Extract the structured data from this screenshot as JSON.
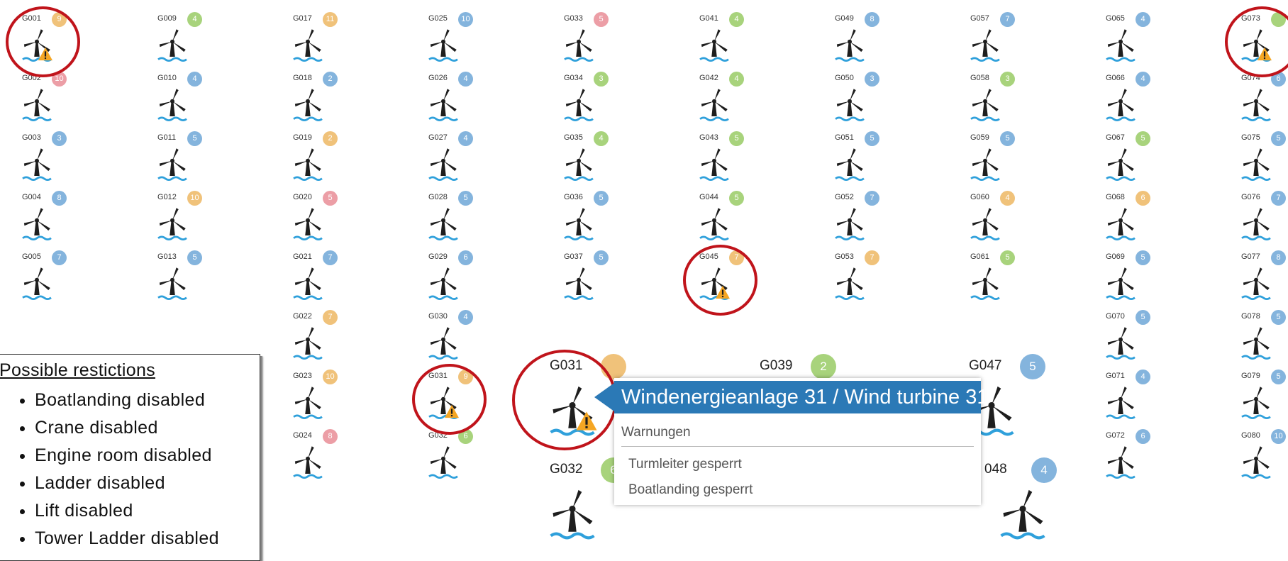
{
  "colors": {
    "blue": "#84b4dd",
    "green": "#a8d37c",
    "orange": "#f0c27a",
    "red": "#ec9ea6",
    "accent": "#2b79b6",
    "ring": "#c0141b",
    "water": "#2fa0db",
    "warning": "#f5a623"
  },
  "icons": {
    "turbine": "wind-turbine-icon",
    "warning": "warning-icon"
  },
  "turbines": [
    {
      "id": "G001",
      "count": "9",
      "status": "orange",
      "warning": true,
      "circled": true
    },
    {
      "id": "G002",
      "count": "10",
      "status": "red"
    },
    {
      "id": "G003",
      "count": "3",
      "status": "blue"
    },
    {
      "id": "G004",
      "count": "8",
      "status": "blue"
    },
    {
      "id": "G005",
      "count": "7",
      "status": "blue"
    },
    {
      "id": "G009",
      "count": "4",
      "status": "green"
    },
    {
      "id": "G010",
      "count": "4",
      "status": "blue"
    },
    {
      "id": "G011",
      "count": "5",
      "status": "blue"
    },
    {
      "id": "G012",
      "count": "10",
      "status": "orange"
    },
    {
      "id": "G013",
      "count": "5",
      "status": "blue"
    },
    {
      "id": "G017",
      "count": "11",
      "status": "orange"
    },
    {
      "id": "G018",
      "count": "2",
      "status": "blue"
    },
    {
      "id": "G019",
      "count": "2",
      "status": "orange"
    },
    {
      "id": "G020",
      "count": "5",
      "status": "red"
    },
    {
      "id": "G021",
      "count": "7",
      "status": "blue"
    },
    {
      "id": "G022",
      "count": "7",
      "status": "orange"
    },
    {
      "id": "G023",
      "count": "10",
      "status": "orange"
    },
    {
      "id": "G024",
      "count": "8",
      "status": "red"
    },
    {
      "id": "G025",
      "count": "10",
      "status": "blue"
    },
    {
      "id": "G026",
      "count": "4",
      "status": "blue"
    },
    {
      "id": "G027",
      "count": "4",
      "status": "blue"
    },
    {
      "id": "G028",
      "count": "5",
      "status": "blue"
    },
    {
      "id": "G029",
      "count": "6",
      "status": "blue"
    },
    {
      "id": "G030",
      "count": "4",
      "status": "blue"
    },
    {
      "id": "G031",
      "count": "9",
      "status": "orange",
      "warning": true,
      "circled": true
    },
    {
      "id": "G032",
      "count": "6",
      "status": "green"
    },
    {
      "id": "G033",
      "count": "5",
      "status": "red"
    },
    {
      "id": "G034",
      "count": "3",
      "status": "green"
    },
    {
      "id": "G035",
      "count": "4",
      "status": "green"
    },
    {
      "id": "G036",
      "count": "5",
      "status": "blue"
    },
    {
      "id": "G037",
      "count": "5",
      "status": "blue"
    },
    {
      "id": "G041",
      "count": "4",
      "status": "green"
    },
    {
      "id": "G042",
      "count": "4",
      "status": "green"
    },
    {
      "id": "G043",
      "count": "5",
      "status": "green"
    },
    {
      "id": "G044",
      "count": "5",
      "status": "green"
    },
    {
      "id": "G045",
      "count": "7",
      "status": "orange",
      "warning": true,
      "circled": true
    },
    {
      "id": "G049",
      "count": "8",
      "status": "blue"
    },
    {
      "id": "G050",
      "count": "3",
      "status": "blue"
    },
    {
      "id": "G051",
      "count": "5",
      "status": "blue"
    },
    {
      "id": "G052",
      "count": "7",
      "status": "blue"
    },
    {
      "id": "G053",
      "count": "7",
      "status": "orange"
    },
    {
      "id": "G057",
      "count": "7",
      "status": "blue"
    },
    {
      "id": "G058",
      "count": "3",
      "status": "green"
    },
    {
      "id": "G059",
      "count": "5",
      "status": "blue"
    },
    {
      "id": "G060",
      "count": "4",
      "status": "orange"
    },
    {
      "id": "G061",
      "count": "5",
      "status": "green"
    },
    {
      "id": "G065",
      "count": "4",
      "status": "blue"
    },
    {
      "id": "G066",
      "count": "4",
      "status": "blue"
    },
    {
      "id": "G067",
      "count": "5",
      "status": "green"
    },
    {
      "id": "G068",
      "count": "6",
      "status": "orange"
    },
    {
      "id": "G069",
      "count": "5",
      "status": "blue"
    },
    {
      "id": "G070",
      "count": "5",
      "status": "blue"
    },
    {
      "id": "G071",
      "count": "4",
      "status": "blue"
    },
    {
      "id": "G072",
      "count": "6",
      "status": "blue"
    },
    {
      "id": "G073",
      "count": "",
      "status": "green",
      "warning": true,
      "circled": true
    },
    {
      "id": "G074",
      "count": "6",
      "status": "blue"
    },
    {
      "id": "G075",
      "count": "5",
      "status": "blue"
    },
    {
      "id": "G076",
      "count": "7",
      "status": "blue"
    },
    {
      "id": "G077",
      "count": "8",
      "status": "blue"
    },
    {
      "id": "G078",
      "count": "5",
      "status": "blue"
    },
    {
      "id": "G079",
      "count": "5",
      "status": "blue"
    },
    {
      "id": "G080",
      "count": "10",
      "status": "blue"
    }
  ],
  "zoomed": [
    {
      "id": "G031",
      "count": "",
      "status": "orange",
      "warning": true,
      "circled": true
    },
    {
      "id": "G032",
      "count": "6",
      "status": "green"
    },
    {
      "id": "G039",
      "count": "2",
      "status": "green"
    },
    {
      "id": "G047",
      "count": "5",
      "status": "blue"
    },
    {
      "id": "",
      "count": "4",
      "status": "blue",
      "suffix": "048"
    }
  ],
  "legend": {
    "title": "Possible restictions",
    "items": [
      "Boatlanding disabled",
      "Crane disabled",
      "Engine room disabled",
      "Ladder disabled",
      "Lift disabled",
      "Tower Ladder disabled"
    ]
  },
  "popup": {
    "title": "Windenergieanlage 31 / Wind turbine 31",
    "section": "Warnungen",
    "warnings": [
      "Turmleiter gesperrt",
      "Boatlanding gesperrt"
    ]
  }
}
